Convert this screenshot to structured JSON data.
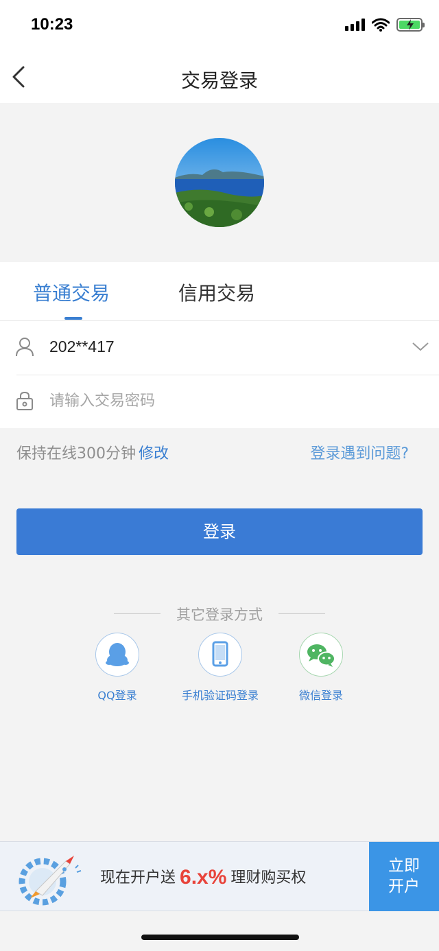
{
  "status_bar": {
    "time": "10:23"
  },
  "nav": {
    "title": "交易登录"
  },
  "tabs": [
    {
      "label": "普通交易",
      "active": true
    },
    {
      "label": "信用交易",
      "active": false
    }
  ],
  "form": {
    "account_value": "202**417",
    "password_placeholder": "请输入交易密码"
  },
  "session": {
    "keep_online_text": "保持在线300分钟",
    "modify_label": "修改",
    "trouble_label": "登录遇到问题?"
  },
  "login_button": "登录",
  "other_login": {
    "title": "其它登录方式",
    "options": [
      {
        "label": "QQ登录",
        "icon": "qq-icon"
      },
      {
        "label": "手机验证码登录",
        "icon": "phone-icon"
      },
      {
        "label": "微信登录",
        "icon": "wechat-icon"
      }
    ]
  },
  "banner": {
    "text_before": "现在开户送",
    "highlight": "6.x%",
    "text_after": "理财购买权",
    "button_line1": "立即",
    "button_line2": "开户"
  },
  "colors": {
    "accent": "#3a7bd5",
    "highlight": "#e8433a",
    "banner_button": "#3b95e6"
  }
}
